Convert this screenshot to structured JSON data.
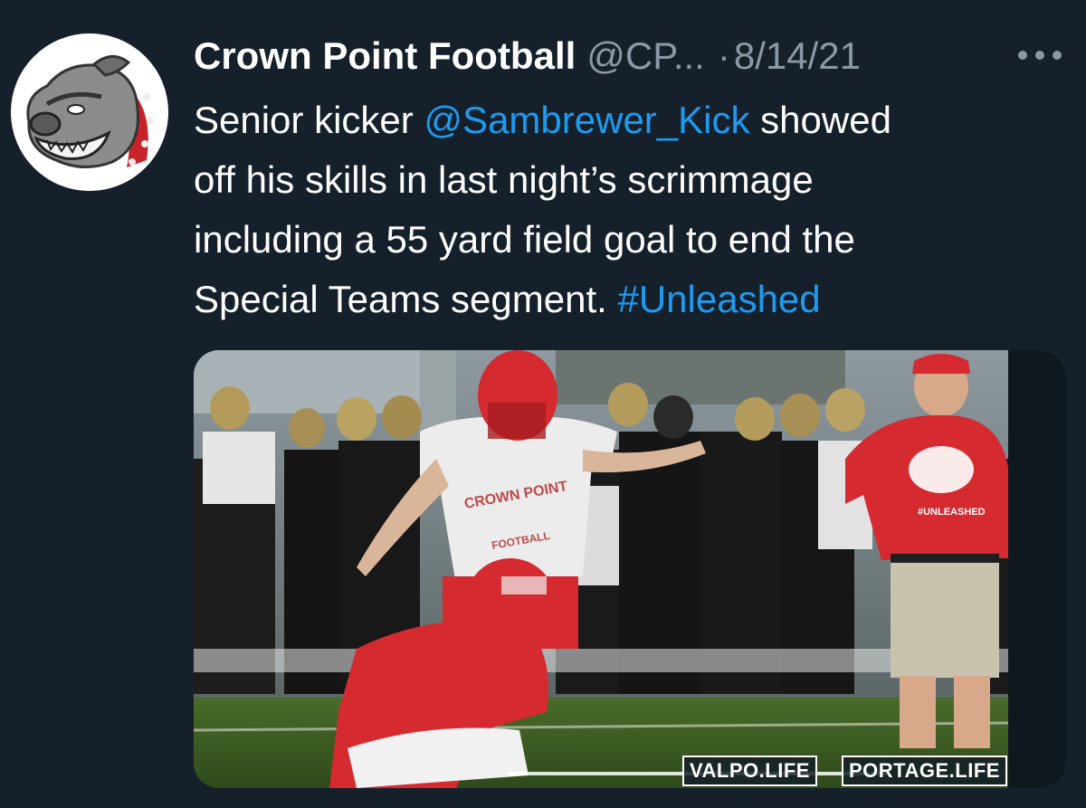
{
  "tweet": {
    "author": {
      "display_name": "Crown Point Football",
      "handle": "@CP...",
      "avatar_icon": "bulldog-mascot-icon"
    },
    "separator": "·",
    "date": "8/14/21",
    "more_icon": "more-options-icon",
    "text": {
      "line1_prefix": "Senior kicker ",
      "mention": "@Sambrewer_Kick",
      "line1_suffix": " showed",
      "line2": "off his skills in last night’s scrimmage",
      "line3": "including a 55 yard field goal to end the",
      "line4_prefix": "Special Teams segment. ",
      "hashtag": "#Unleashed"
    },
    "media": {
      "jersey_text": "CROWN POINT",
      "jersey_subtext": "FOOTBALL",
      "coach_shirt_text": "#UNLEASHED",
      "watermark_1": "VALPO.LIFE",
      "watermark_2": "PORTAGE.LIFE"
    }
  },
  "colors": {
    "background": "#15202b",
    "text": "#ffffff",
    "secondary": "#8b98a5",
    "link": "#1d9bf0",
    "team_red": "#d42a30"
  }
}
